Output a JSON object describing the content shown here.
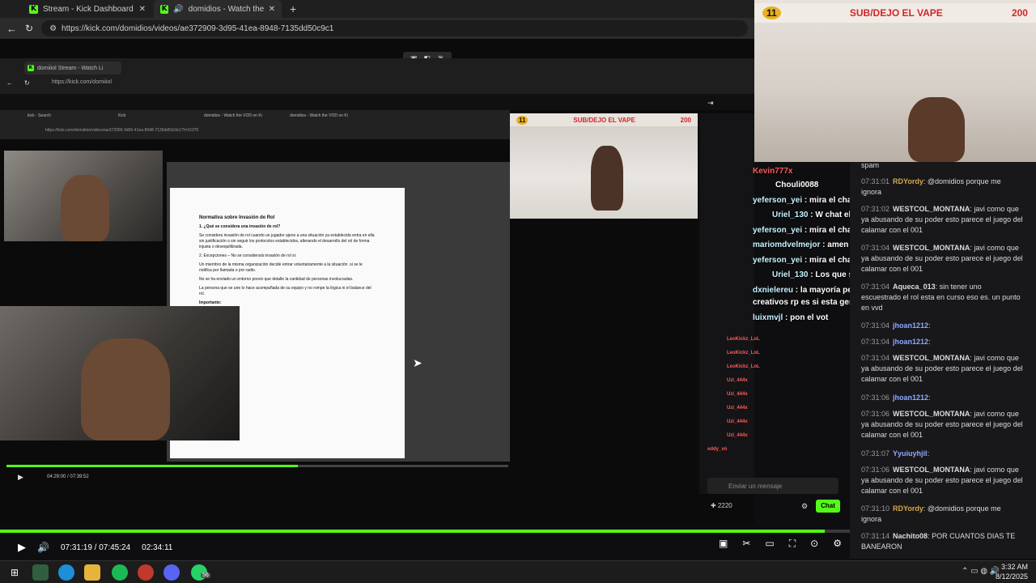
{
  "browser": {
    "tabs": [
      {
        "title": "Stream - Kick Dashboard"
      },
      {
        "title": "domidios - Watch the VOD o"
      }
    ],
    "url": "https://kick.com/domidios/videos/ae372909-3d95-41ea-8948-7135dd50c9c1"
  },
  "nested_browser": {
    "tab": "domiiiol Stream - Watch Li",
    "url": "https://kick.com/domiiiol"
  },
  "inner_browser": {
    "tabs": [
      "kick - Search",
      "Kick",
      "domidios - Watch the VOD on Ki",
      "domidios - Watch the VOD on Ki"
    ],
    "url": "https://kick.com/domidios/videos/ae372909-3d95-41ea-8948-7135dd50c9c1?t=15376"
  },
  "document": {
    "heading": "Normativa sobre Invasión de Rol",
    "subheading": "1. ¿Qué se considera una invasión de rol?",
    "paragraphs": [
      "Se considera invasión de rol cuando un jugador ajeno a una situación ya establecida entra en ella sin justificación o sin seguir los protocolos establecidos, alterando el desarrollo del rol de forma injusta o desequilibrada.",
      "2. Excepciones – No se considerará invasión de rol si:",
      "Un miembro de la misma organización decide entrar voluntariamente a la situación .si se le notifica por llamada o por radio.",
      "No se ha enviado un entorno previo que detalle la cantidad de personas involucradas.",
      "La persona que se une lo hace acompañada de su equipo y no rompe la lógica ni el balance del rol.",
      "Importante:"
    ]
  },
  "inner_stream_banner": {
    "left": "11",
    "title": "SUB/DEJO EL VAPE",
    "right": "200"
  },
  "webcam_banner": {
    "left": "11",
    "title": "SUB/DEJO EL VAPE",
    "right": "200"
  },
  "overlay_chat": [
    {
      "user": "Kevin777x",
      "text": ""
    },
    {
      "user": "Chouli0088",
      "text": ""
    },
    {
      "user": "yeferson_yei",
      "text": "mira el chat de domidios"
    },
    {
      "user": "Uriel_130",
      "text": "W chat el mejor"
    },
    {
      "user": "yeferson_yei",
      "text": "mira el chat de domidios"
    },
    {
      "user": "mariomdvelmejor",
      "text": "amen amén"
    },
    {
      "user": "yeferson_yei",
      "text": "mira el chat de domidios"
    },
    {
      "user": "Uriel_130",
      "text": "Los que sí entretienen"
    },
    {
      "user": "dxnielereu",
      "text": "la mayoría pensamos eso pero en los mejores momentos de"
    },
    {
      "user": "",
      "text": "creativos rp es si esta gente"
    },
    {
      "user": "luixmvjl",
      "text": "pon el vot"
    }
  ],
  "inner_chat_names": [
    "LeoKickz_LoL",
    "LeoKickz_LoL",
    "LeoKickz_LoL",
    "Uzi_444x",
    "Uzi_444x",
    "Uzi_444x",
    "Uzi_444x",
    "Uzi_444x",
    "eddy_vn"
  ],
  "inner_chat_input": {
    "placeholder": "Enviar un mensaje",
    "button": "Chat",
    "points": "2220"
  },
  "right_chat": [
    {
      "time": "",
      "user": "",
      "text": "spam",
      "color": "#dcdcdc"
    },
    {
      "time": "07:31:01",
      "user": "RDYordy",
      "text": "@domidios porque me ignora",
      "color": "#d4a94a"
    },
    {
      "time": "07:31:02",
      "user": "WESTCOL_MONTANA",
      "text": "javi como que ya abusando de su poder esto parece el juego del calamar con el 001",
      "color": "#cfcfcf"
    },
    {
      "time": "07:31:04",
      "user": "WESTCOL_MONTANA",
      "text": "javi como que ya abusando de su poder esto parece el juego del calamar con el 001",
      "color": "#cfcfcf"
    },
    {
      "time": "07:31:04",
      "user": "Aqueca_013",
      "text": "sin tener uno escuestrado el rol esta en curso eso es. un punto en vvd",
      "color": "#cfcfcf"
    },
    {
      "time": "07:31:04",
      "user": "jhoan1212",
      "text": "",
      "color": "#8fa8ff"
    },
    {
      "time": "07:31:04",
      "user": "jhoan1212",
      "text": "",
      "color": "#8fa8ff"
    },
    {
      "time": "07:31:04",
      "user": "WESTCOL_MONTANA",
      "text": "javi como que ya abusando de su poder esto parece el juego del calamar con el 001",
      "color": "#cfcfcf"
    },
    {
      "time": "07:31:06",
      "user": "jhoan1212",
      "text": "",
      "color": "#8fa8ff"
    },
    {
      "time": "07:31:06",
      "user": "WESTCOL_MONTANA",
      "text": "javi como que ya abusando de su poder esto parece el juego del calamar con el 001",
      "color": "#cfcfcf"
    },
    {
      "time": "07:31:07",
      "user": "Yyuiuyhjil",
      "text": "",
      "color": "#8fa8ff"
    },
    {
      "time": "07:31:06",
      "user": "WESTCOL_MONTANA",
      "text": "javi como que ya abusando de su poder esto parece el juego del calamar con el 001",
      "color": "#cfcfcf"
    },
    {
      "time": "07:31:10",
      "user": "RDYordy",
      "text": "@domidios porque me ignora",
      "color": "#d4a94a"
    },
    {
      "time": "07:31:14",
      "user": "Nachito08",
      "text": "POR CUANTOS DIAS TE BANEARON",
      "color": "#cfcfcf"
    }
  ],
  "player": {
    "time": "07:31:19 / 07:45:24",
    "clip_time": "02:34:11",
    "progress": 0.97,
    "inner_time": "04:29:00 / 07:39:52",
    "inner_progress": 0.58
  },
  "taskbar": {
    "time": "3:32 AM",
    "date": "8/12/2025",
    "notification": "56"
  },
  "inner_taskbar": {
    "time": "2:34 a. m.",
    "date": "12/8/2025"
  },
  "colors": {
    "kick_green": "#53fc18",
    "banner_red": "#d1262a"
  }
}
